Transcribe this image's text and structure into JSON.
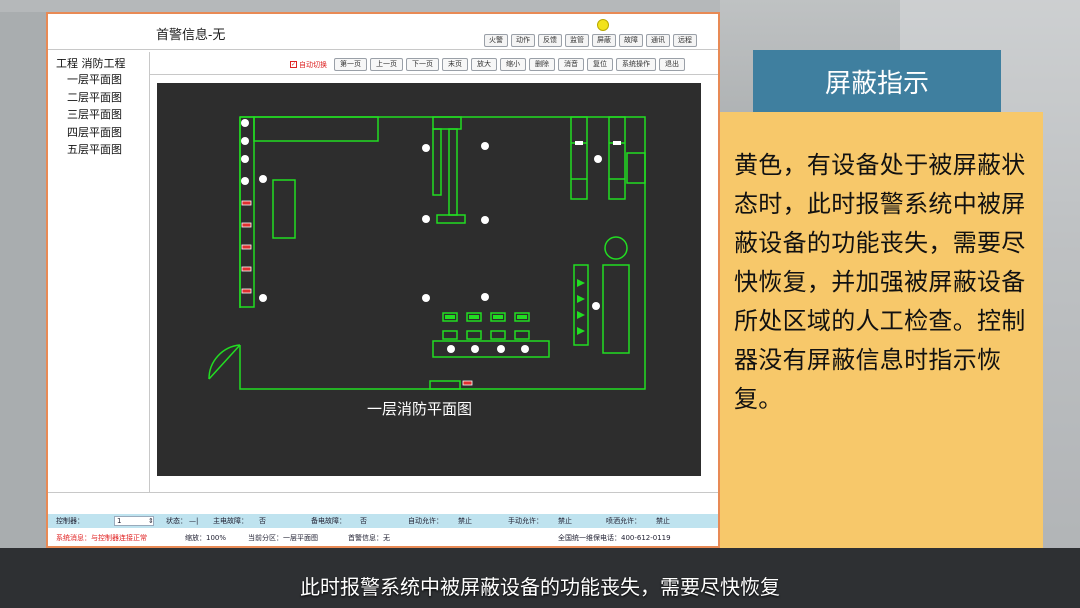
{
  "app": {
    "title": "首警信息-无",
    "top_buttons": [
      "火警",
      "动作",
      "反馈",
      "监管",
      "屏蔽",
      "故障",
      "通讯",
      "远程"
    ]
  },
  "tree": {
    "root": "工程   消防工程",
    "floors": [
      "一层平面图",
      "二层平面图",
      "三层平面图",
      "四层平面图",
      "五层平面图"
    ]
  },
  "controls": {
    "auto_switch_label": "自动切换",
    "auto_switch_checked": true,
    "buttons": [
      "第一页",
      "上一页",
      "下一页",
      "末页",
      "放大",
      "缩小",
      "删除",
      "消音",
      "复位",
      "系统操作",
      "退出"
    ]
  },
  "map": {
    "label": "一层消防平面图",
    "line_color": "#22dd22",
    "device_color": "#ffffff",
    "shielded_color": "#e03030"
  },
  "status_bar": {
    "controller_label": "控制器：",
    "controller_value": "1",
    "state_label": "状态：",
    "state_value": "—|",
    "main_power_label": "主电故障：",
    "main_power_value": "否",
    "backup_power_label": "备电故障：",
    "backup_power_value": "否",
    "auto_allow_label": "自动允许：",
    "auto_allow_value": "禁止",
    "manual_allow_label": "手动允许：",
    "manual_allow_value": "禁止",
    "spray_allow_label": "喷洒允许：",
    "spray_allow_value": "禁止"
  },
  "info_bar": {
    "system_message": "系统消息：与控制器连接正常",
    "zoom": "缩放：100%",
    "current_zone": "当前分区：一层平面图",
    "first_alarm": "首警信息：无",
    "hotline": "全国统一维保电话：400-612-0119"
  },
  "callout": {
    "title": "屏蔽指示",
    "text": "黄色，有设备处于被屏蔽状态时，此时报警系统中被屏蔽设备的功能丧失，需要尽快恢复，并加强被屏蔽设备所处区域的人工检查。控制器没有屏蔽信息时指示恢复。"
  },
  "subtitle": "此时报警系统中被屏蔽设备的功能丧失，需要尽快恢复"
}
